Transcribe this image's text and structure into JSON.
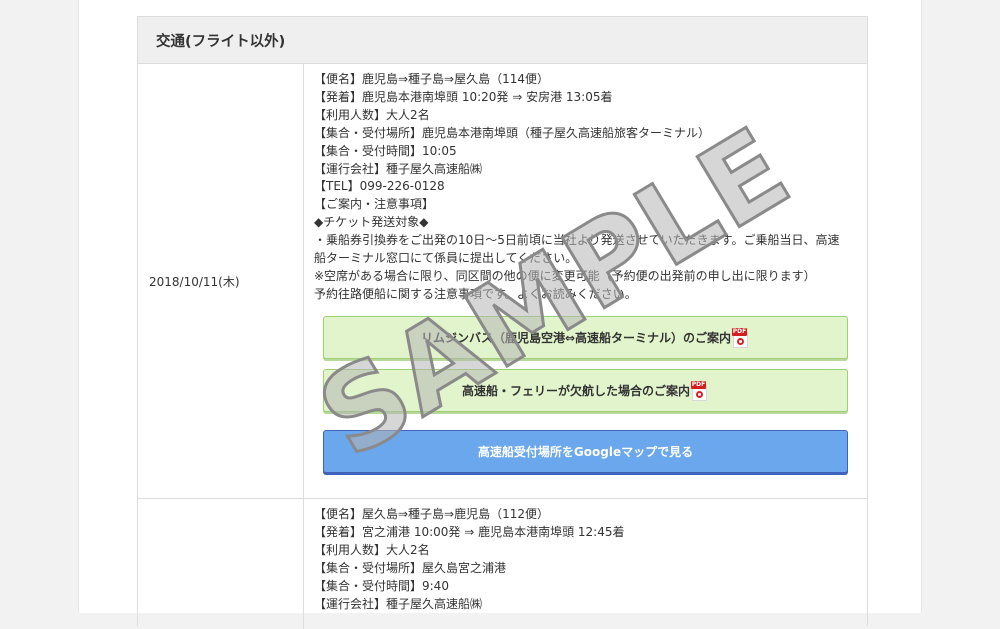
{
  "section": {
    "title": "交通(フライト以外)"
  },
  "entries": [
    {
      "date": "2018/10/11(木)",
      "lines": [
        "【便名】鹿児島⇒種子島⇒屋久島（114便）",
        "【発着】鹿児島本港南埠頭 10:20発 ⇒ 安房港 13:05着",
        "【利用人数】大人2名",
        "【集合・受付場所】鹿児島本港南埠頭（種子屋久高速船旅客ターミナル）",
        "【集合・受付時間】10:05",
        "【運行会社】種子屋久高速船㈱",
        "【TEL】099-226-0128",
        "【ご案内・注意事項】",
        "◆チケット発送対象◆",
        "・乗船券引換券をご出発の10日～5日前頃に当社より発送させていただきます。ご乗船当日、高速",
        "船ターミナル窓口にて係員に提出してください。",
        "※空席がある場合に限り、同区間の他の便に変更可能（予約便の出発前の申し出に限ります）",
        "予約往路便船に関する注意事項です。よくお読みください。"
      ],
      "buttons": {
        "limousine_bus": "リムジンバス（鹿児島空港⇔高速船ターミナル）のご案内",
        "cancellation": "高速船・フェリーが欠航した場合のご案内",
        "google_map": "高速船受付場所をGoogleマップで見る"
      }
    },
    {
      "date": "",
      "lines": [
        "【便名】屋久島⇒種子島⇒鹿児島（112便）",
        "【発着】宮之浦港 10:00発 ⇒ 鹿児島本港南埠頭 12:45着",
        "【利用人数】大人2名",
        "【集合・受付場所】屋久島宮之浦港",
        "【集合・受付時間】9:40",
        "【運行会社】種子屋久高速船㈱"
      ]
    }
  ],
  "pdf_icon_label": "PDF",
  "watermark": "SAMPLE",
  "colors": {
    "header_bg": "#efefef",
    "green_button": "#e2f4cc",
    "blue_button": "#6aa7ec",
    "pdf_red": "#d21f1f"
  }
}
